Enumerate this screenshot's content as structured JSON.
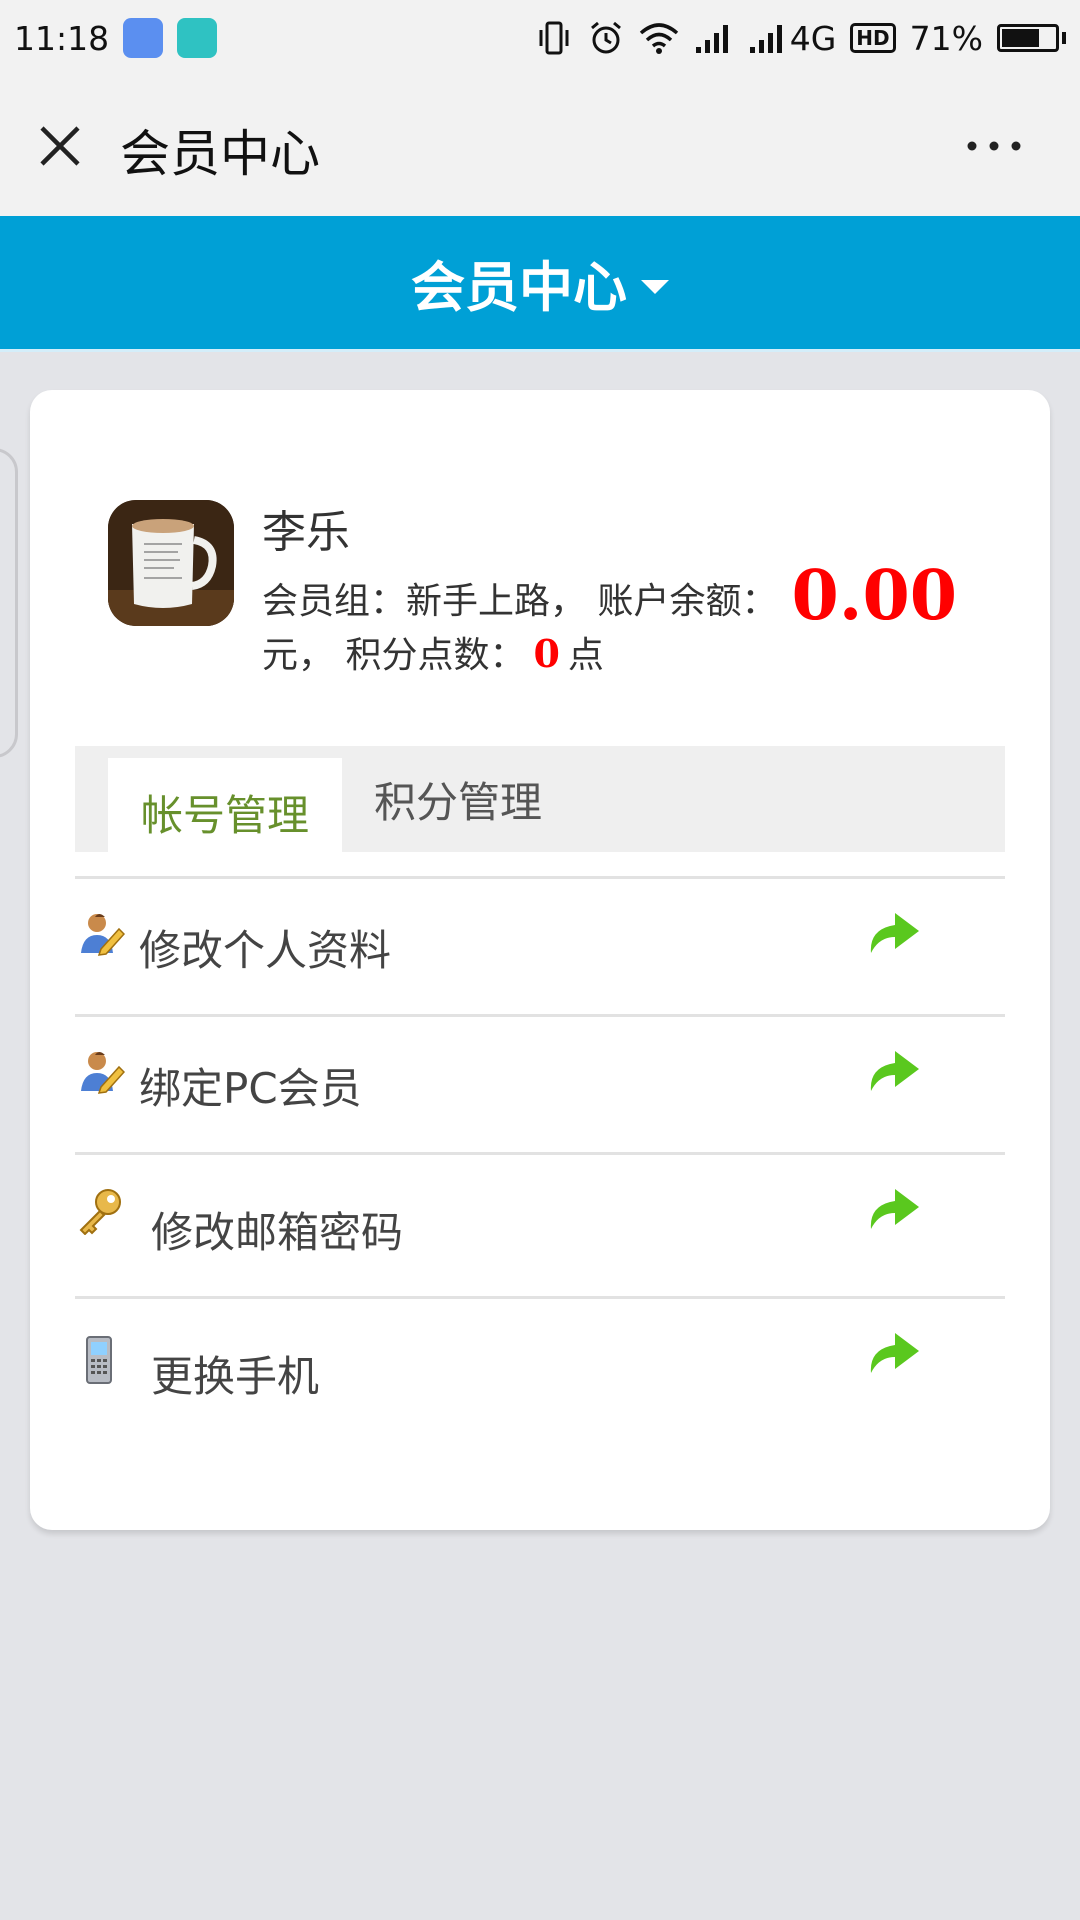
{
  "status_bar": {
    "time": "11:18",
    "network": "4G",
    "hd": "HD",
    "battery_text": "71%",
    "battery_level": 0.71
  },
  "title_bar": {
    "title": "会员中心"
  },
  "header": {
    "title": "会员中心"
  },
  "profile": {
    "name": "李乐",
    "group_label": "会员组：新手上路， 账户余额：",
    "balance": "0.00",
    "yuan_label": "元， 积分点数：",
    "points": "0",
    "points_unit": "点"
  },
  "tabs": [
    {
      "label": "帐号管理",
      "active": true
    },
    {
      "label": "积分管理",
      "active": false
    }
  ],
  "menu": [
    {
      "label": "修改个人资料",
      "icon": "user-edit-icon"
    },
    {
      "label": "绑定PC会员",
      "icon": "user-edit-icon"
    },
    {
      "label": "修改邮箱密码",
      "icon": "key-icon"
    },
    {
      "label": "更换手机",
      "icon": "mobile-phone-icon"
    }
  ],
  "colors": {
    "header_blue": "#00a0d6",
    "active_tab": "#67902c",
    "arrow_green": "#5ac81e",
    "value_red": "#ff0000"
  }
}
